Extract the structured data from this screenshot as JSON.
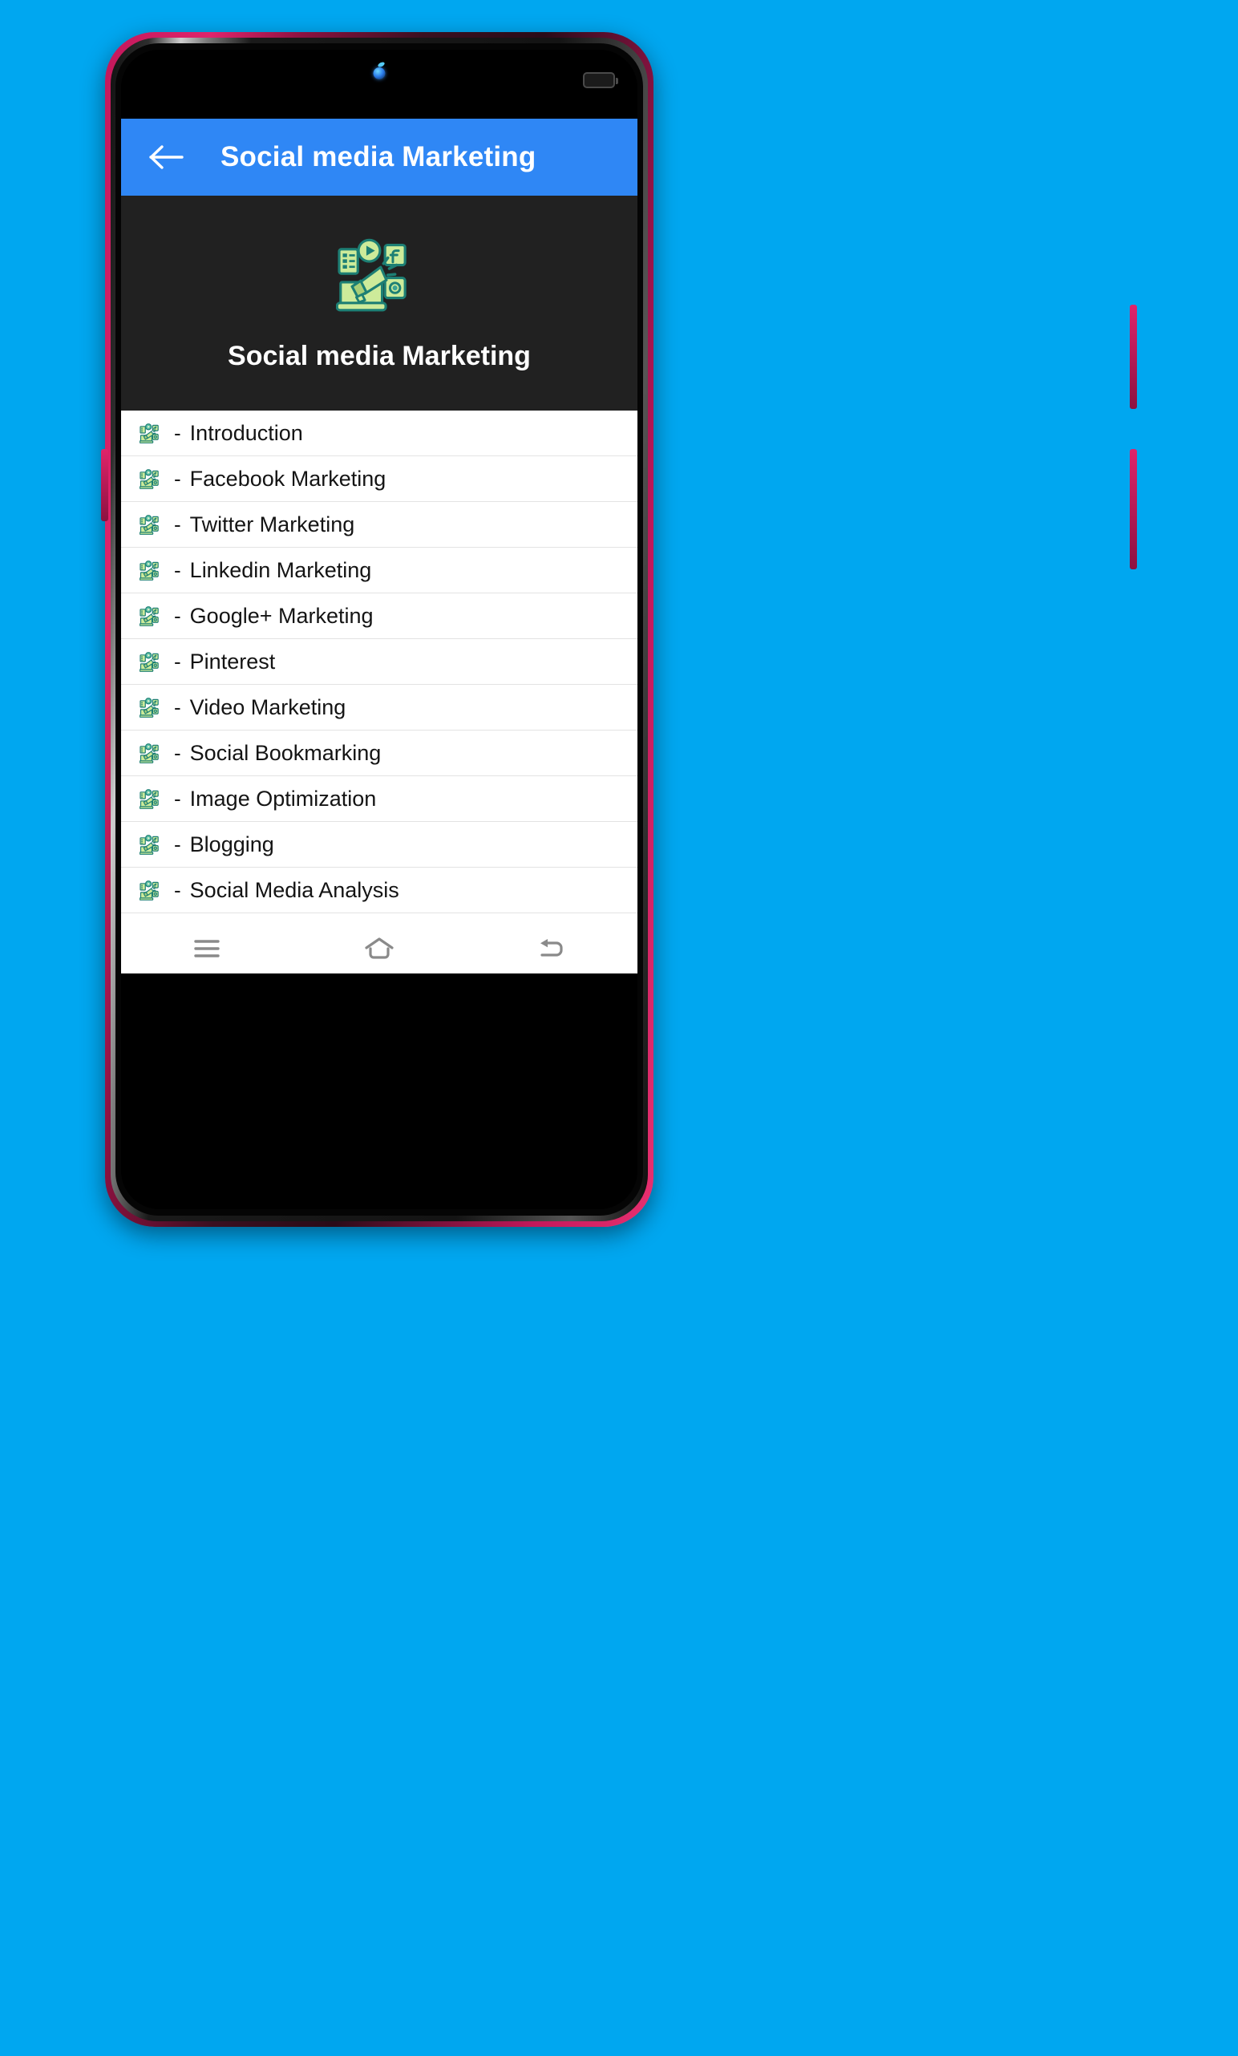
{
  "theme": {
    "page_background": "#00a7f0",
    "app_bar_color": "#2f87f5",
    "hero_background": "#212121",
    "list_background": "#ffffff",
    "divider_color": "#e3e3e3",
    "icon_green_light": "#c3e88d",
    "icon_green_dark": "#1f7a6e",
    "nav_icon_color": "#8a8a8a"
  },
  "status_bar": {
    "camera_icon": "front-camera-icon",
    "battery_icon": "battery-icon"
  },
  "app_bar": {
    "back_icon": "arrow-left-icon",
    "title": "Social media Marketing"
  },
  "hero": {
    "icon": "social-media-marketing-icon",
    "title": "Social media Marketing"
  },
  "list": {
    "item_icon": "social-media-marketing-icon",
    "bullet": "-",
    "items": [
      {
        "label": "Introduction"
      },
      {
        "label": "Facebook Marketing"
      },
      {
        "label": "Twitter Marketing"
      },
      {
        "label": "Linkedin Marketing"
      },
      {
        "label": "Google+ Marketing"
      },
      {
        "label": "Pinterest"
      },
      {
        "label": "Video Marketing"
      },
      {
        "label": "Social Bookmarking"
      },
      {
        "label": "Image Optimization"
      },
      {
        "label": "Blogging"
      },
      {
        "label": "Social Media Analysis"
      }
    ]
  },
  "nav_bar": {
    "buttons": [
      {
        "icon": "recents-menu-icon",
        "name": "recents"
      },
      {
        "icon": "home-icon",
        "name": "home"
      },
      {
        "icon": "back-return-icon",
        "name": "back"
      }
    ]
  }
}
